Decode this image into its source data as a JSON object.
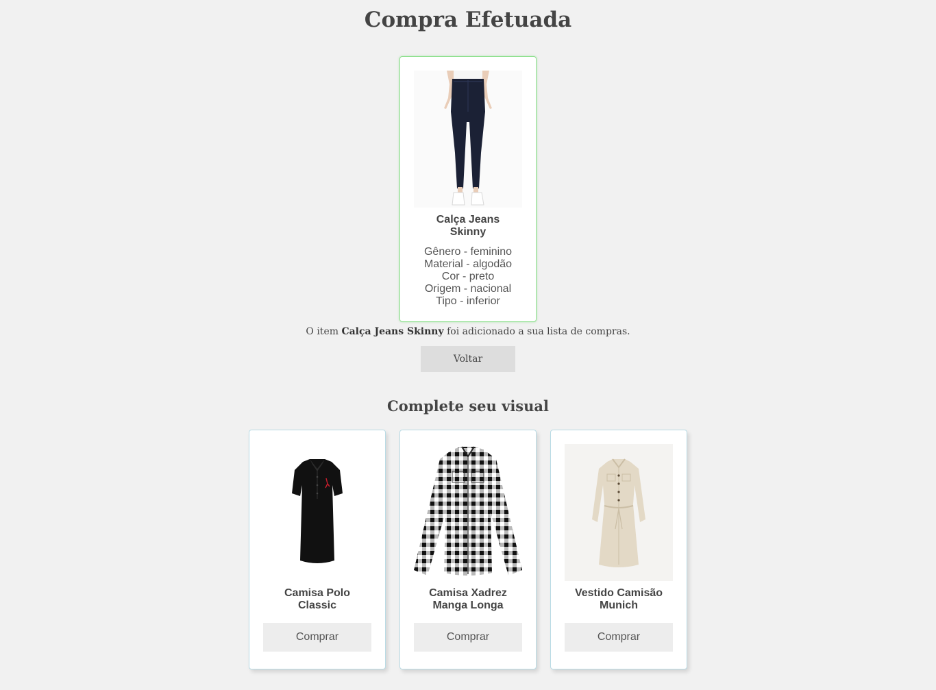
{
  "page": {
    "title": "Compra Efetuada"
  },
  "purchased": {
    "name": "Calça Jeans Skinny",
    "specs": [
      "Gênero - feminino",
      "Material - algodão",
      "Cor - preto",
      "Origem - nacional",
      "Tipo - inferior"
    ]
  },
  "confirmation": {
    "prefix": "O item",
    "item": "Calça Jeans Skinny",
    "suffix": "foi adicionado a sua lista de compras."
  },
  "back_button": "Voltar",
  "recommendations": {
    "title": "Complete seu visual",
    "items": [
      {
        "name": "Camisa Polo Classic",
        "button": "Comprar",
        "image": "black-polo-shirt"
      },
      {
        "name": "Camisa Xadrez Manga Longa",
        "button": "Comprar",
        "image": "plaid-long-sleeve-shirt"
      },
      {
        "name": "Vestido Camisão Munich",
        "button": "Comprar",
        "image": "beige-shirt-dress"
      }
    ]
  },
  "colors": {
    "background": "#f1f1f1",
    "text": "#444444",
    "purchased_border": "#8fe08f",
    "card_border": "#b9dbe5",
    "button": "#dddddd"
  }
}
